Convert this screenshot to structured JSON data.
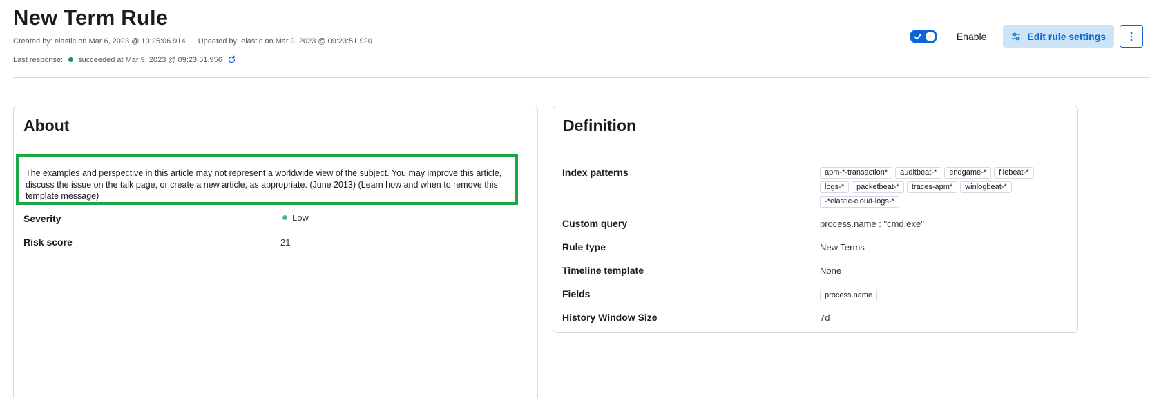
{
  "header": {
    "title": "New Term Rule",
    "created_by": "Created by: elastic on Mar 6, 2023 @ 10:25:06.914",
    "updated_by": "Updated by: elastic on Mar 9, 2023 @ 09:23:51.920",
    "last_response_label": "Last response:",
    "last_response_status": "succeeded at Mar 9, 2023 @ 09:23:51.956",
    "enable_label": "Enable",
    "enabled": true,
    "edit_button_label": "Edit rule settings"
  },
  "about": {
    "title": "About",
    "notice_text": "The examples and perspective in this article may not represent a worldwide view of the subject. You may improve this article, discuss the issue on the talk page, or create a new article, as appropriate. (June 2013) (Learn how and when to remove this template message)",
    "rows": [
      {
        "label": "Severity",
        "value": "Low"
      },
      {
        "label": "Risk score",
        "value": "21"
      }
    ]
  },
  "definition": {
    "title": "Definition",
    "index_patterns_label": "Index patterns",
    "index_patterns": [
      "apm-*-transaction*",
      "auditbeat-*",
      "endgame-*",
      "filebeat-*",
      "logs-*",
      "packetbeat-*",
      "traces-apm*",
      "winlogbeat-*",
      "-*elastic-cloud-logs-*"
    ],
    "custom_query_label": "Custom query",
    "custom_query": "process.name : \"cmd.exe\"",
    "rule_type_label": "Rule type",
    "rule_type": "New Terms",
    "timeline_template_label": "Timeline template",
    "timeline_template": "None",
    "fields_label": "Fields",
    "fields": [
      "process.name"
    ],
    "history_window_label": "History Window Size",
    "history_window": "7d"
  },
  "colors": {
    "primary": "#0b64dd",
    "success": "#1b8a78",
    "severity_low": "#54b399",
    "highlight_border": "#1aa847"
  }
}
